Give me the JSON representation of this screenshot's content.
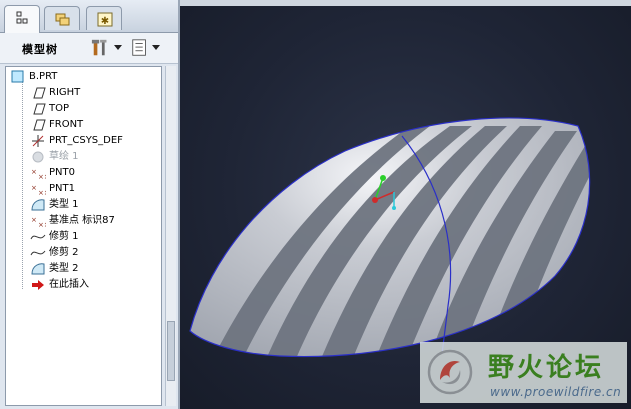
{
  "tabs": [
    {
      "name": "model-tree-tab",
      "active": true
    },
    {
      "name": "folder-browser-tab",
      "active": false
    },
    {
      "name": "favorites-tab",
      "active": false
    }
  ],
  "toolbar": {
    "title": "模型树"
  },
  "tree": {
    "items": [
      {
        "label": "B.PRT",
        "icon": "part-icon"
      },
      {
        "label": "RIGHT",
        "icon": "datum-plane-icon"
      },
      {
        "label": "TOP",
        "icon": "datum-plane-icon"
      },
      {
        "label": "FRONT",
        "icon": "datum-plane-icon"
      },
      {
        "label": "PRT_CSYS_DEF",
        "icon": "csys-icon"
      },
      {
        "label": "草绘 1",
        "icon": "sketch-icon",
        "suppressed": true
      },
      {
        "label": "PNT0",
        "icon": "datum-point-icon"
      },
      {
        "label": "PNT1",
        "icon": "datum-point-icon"
      },
      {
        "label": "类型 1",
        "icon": "surface-icon"
      },
      {
        "label": "基准点 标识87",
        "icon": "datum-point-icon"
      },
      {
        "label": "修剪 1",
        "icon": "trim-icon"
      },
      {
        "label": "修剪 2",
        "icon": "trim-icon"
      },
      {
        "label": "类型 2",
        "icon": "surface-icon"
      },
      {
        "label": "在此插入",
        "icon": "insert-here-arrow-icon"
      }
    ]
  },
  "watermark": {
    "title": "野火论坛",
    "url": "www.proewildfire.cn"
  },
  "colors": {
    "background": "#1f2536",
    "surface_light": "#c9ccd3",
    "surface_dark": "#6e7480",
    "edge": "#2a2fc8",
    "watermark_green": "#3a7f20"
  }
}
